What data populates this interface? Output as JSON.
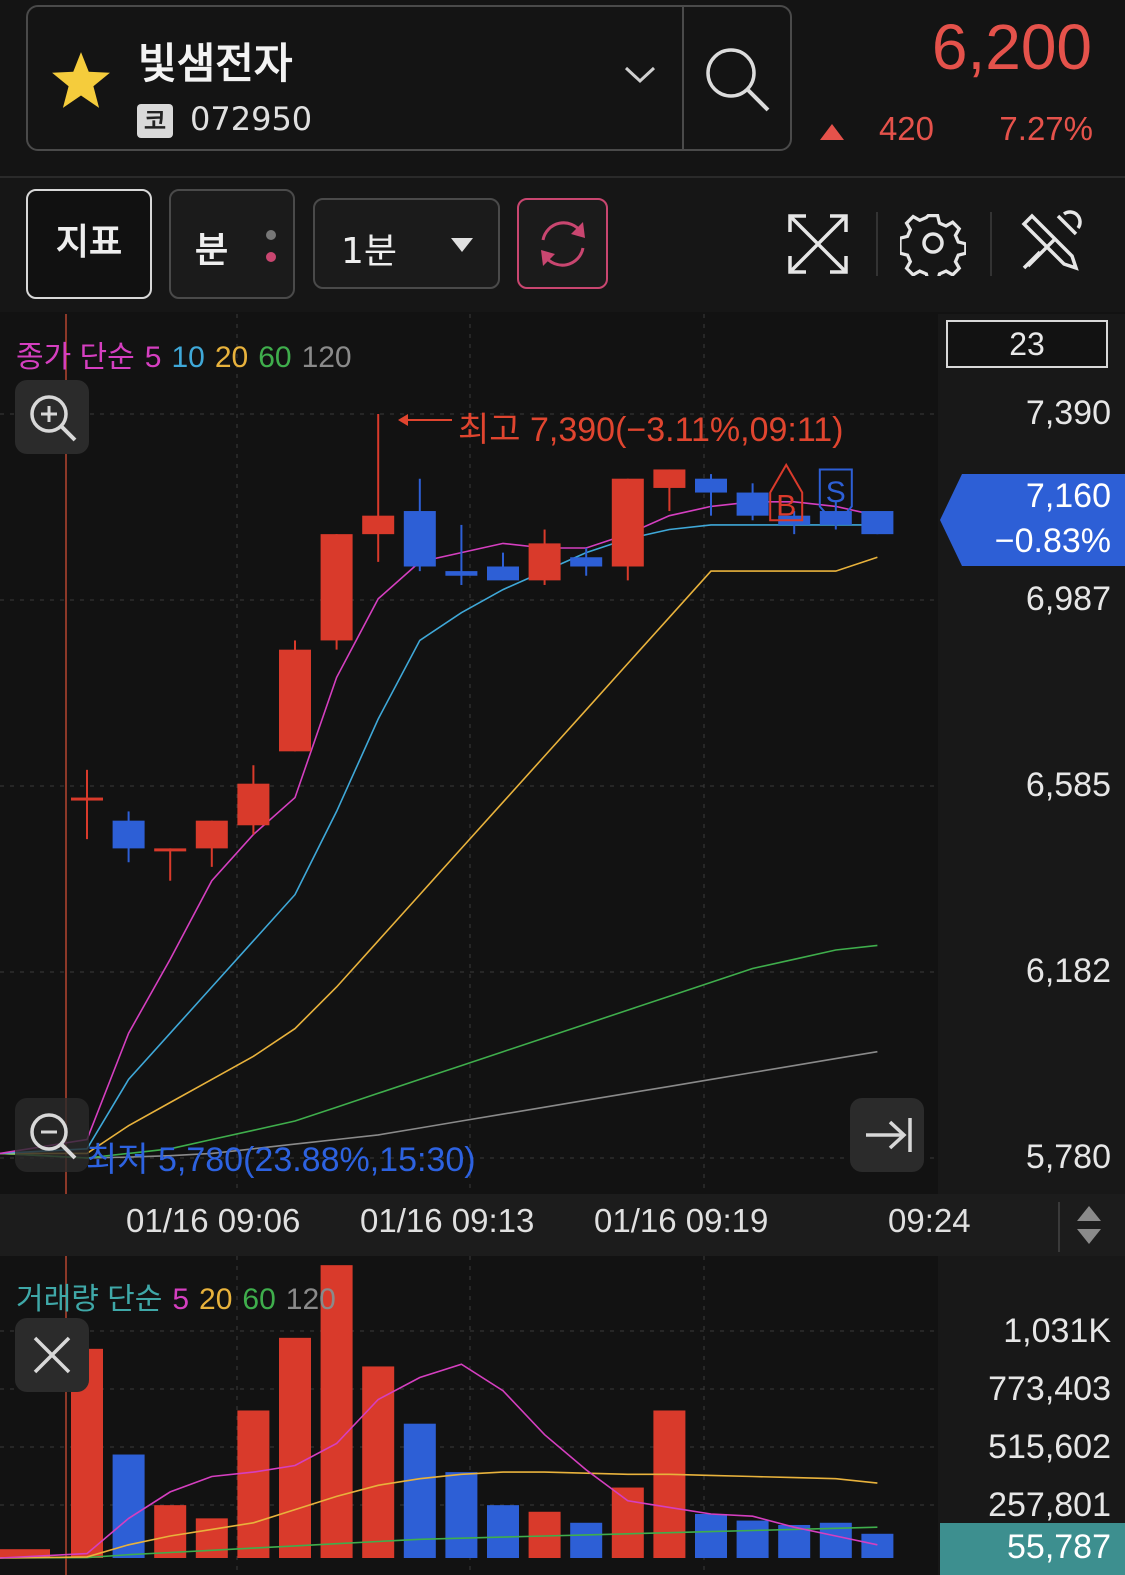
{
  "header": {
    "stock_name": "빛샘전자",
    "market_badge": "코",
    "stock_code": "072950",
    "price": "6,200",
    "change": "420",
    "change_pct": "7.27%"
  },
  "toolbar": {
    "indicator_label": "지표",
    "minute_label": "분",
    "interval_label": "1분"
  },
  "price_chart": {
    "ma_legend": {
      "title": "종가 단순",
      "periods": [
        "5",
        "10",
        "20",
        "60",
        "120"
      ]
    },
    "count_box": "23",
    "y_ticks": [
      "7,390",
      "6,987",
      "6,585",
      "6,182",
      "5,780"
    ],
    "current_price_label": "7,160",
    "current_change_label": "−0.83%",
    "high_annotation": "최고 7,390(−3.11%,09:11)",
    "low_annotation": "최저 5,780(23.88%,15:30)",
    "buy_marker": "B",
    "sell_marker": "S",
    "x_ticks": [
      "01/16 09:06",
      "01/16 09:13",
      "01/16 09:19",
      "09:24"
    ]
  },
  "volume_chart": {
    "ma_legend": {
      "title": "거래량 단순",
      "periods": [
        "5",
        "20",
        "60",
        "120"
      ]
    },
    "y_ticks": [
      "1,031K",
      "773,403",
      "515,602",
      "257,801"
    ],
    "current_volume_label": "55,787"
  },
  "colors": {
    "up": "#d93a2b",
    "down": "#2d5fd6",
    "ma5": "#d53fc0",
    "ma10": "#3fa8d8",
    "ma20": "#e8b23c",
    "ma60": "#3fae4c",
    "ma120": "#8a8a8a",
    "accent_pink": "#c94670"
  },
  "chart_data": {
    "type": "candlestick",
    "candles": [
      {
        "o": 6560,
        "h": 6620,
        "l": 6470,
        "c": 6560
      },
      {
        "o": 6510,
        "h": 6530,
        "l": 6420,
        "c": 6450
      },
      {
        "o": 6450,
        "h": 6450,
        "l": 6380,
        "c": 6450
      },
      {
        "o": 6450,
        "h": 6510,
        "l": 6410,
        "c": 6510
      },
      {
        "o": 6500,
        "h": 6630,
        "l": 6480,
        "c": 6590
      },
      {
        "o": 6660,
        "h": 6900,
        "l": 6660,
        "c": 6880
      },
      {
        "o": 6900,
        "h": 7130,
        "l": 6880,
        "c": 7130
      },
      {
        "o": 7130,
        "h": 7390,
        "l": 7070,
        "c": 7170
      },
      {
        "o": 7180,
        "h": 7250,
        "l": 7050,
        "c": 7060
      },
      {
        "o": 7050,
        "h": 7150,
        "l": 7020,
        "c": 7040
      },
      {
        "o": 7060,
        "h": 7090,
        "l": 7030,
        "c": 7030
      },
      {
        "o": 7030,
        "h": 7140,
        "l": 7020,
        "c": 7110
      },
      {
        "o": 7080,
        "h": 7100,
        "l": 7040,
        "c": 7060
      },
      {
        "o": 7060,
        "h": 7250,
        "l": 7030,
        "c": 7250
      },
      {
        "o": 7230,
        "h": 7270,
        "l": 7180,
        "c": 7270
      },
      {
        "o": 7250,
        "h": 7260,
        "l": 7170,
        "c": 7220
      },
      {
        "o": 7220,
        "h": 7240,
        "l": 7160,
        "c": 7170
      },
      {
        "o": 7170,
        "h": 7180,
        "l": 7130,
        "c": 7150
      },
      {
        "o": 7180,
        "h": 7200,
        "l": 7140,
        "c": 7150
      },
      {
        "o": 7180,
        "h": 7180,
        "l": 7130,
        "c": 7130
      }
    ],
    "ma5": [
      5820,
      6050,
      6210,
      6380,
      6480,
      6560,
      6820,
      6990,
      7070,
      7090,
      7110,
      7100,
      7100,
      7130,
      7170,
      7190,
      7200,
      7200,
      7190,
      7170
    ],
    "ma10": [
      5800,
      5950,
      6050,
      6150,
      6250,
      6350,
      6530,
      6730,
      6900,
      6960,
      7010,
      7050,
      7090,
      7120,
      7140,
      7150,
      7150,
      7150,
      7150,
      7150
    ],
    "ma20": [
      5790,
      5850,
      5900,
      5950,
      6000,
      6060,
      6150,
      6250,
      6350,
      6450,
      6550,
      6650,
      6750,
      6850,
      6950,
      7050,
      7050,
      7050,
      7050,
      7080
    ],
    "ma60": [
      5780,
      5790,
      5800,
      5820,
      5840,
      5860,
      5890,
      5920,
      5950,
      5980,
      6010,
      6040,
      6070,
      6100,
      6130,
      6160,
      6190,
      6210,
      6230,
      6240
    ],
    "ma120": [
      5780,
      5782,
      5785,
      5790,
      5800,
      5810,
      5820,
      5830,
      5845,
      5860,
      5875,
      5890,
      5905,
      5920,
      5935,
      5950,
      5965,
      5980,
      5995,
      6010
    ],
    "ylim": [
      5780,
      7390
    ],
    "volume": [
      950000,
      470000,
      240000,
      180000,
      670000,
      1000000,
      1330000,
      870000,
      610000,
      390000,
      240000,
      210000,
      160000,
      320000,
      670000,
      200000,
      170000,
      150000,
      160000,
      110000
    ],
    "volume_ma5": [
      20000,
      180000,
      300000,
      370000,
      390000,
      420000,
      520000,
      720000,
      820000,
      880000,
      760000,
      560000,
      400000,
      260000,
      230000,
      200000,
      190000,
      140000,
      100000,
      60000
    ],
    "volume_ma20": [
      5000,
      60000,
      100000,
      130000,
      160000,
      220000,
      280000,
      330000,
      360000,
      380000,
      390000,
      390000,
      385000,
      380000,
      380000,
      375000,
      370000,
      365000,
      360000,
      340000
    ],
    "volume_ma60": [
      2000,
      15000,
      25000,
      35000,
      45000,
      55000,
      65000,
      75000,
      85000,
      90000,
      95000,
      100000,
      105000,
      110000,
      115000,
      120000,
      125000,
      130000,
      135000,
      140000
    ],
    "volume_ylim": [
      0,
      1031000
    ]
  }
}
